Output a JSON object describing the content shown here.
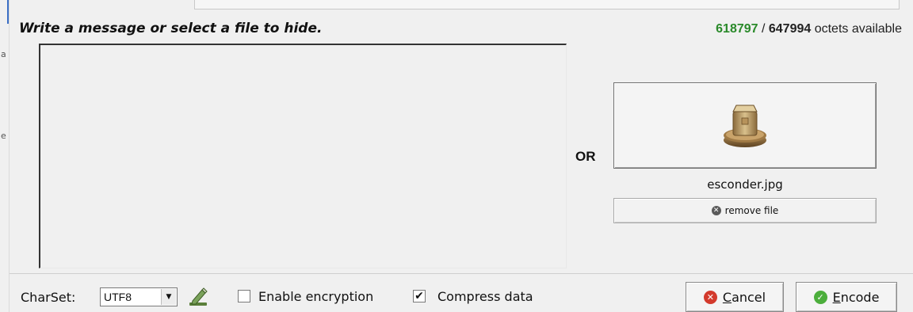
{
  "header": {
    "headline": "Write a message or select a file to hide.",
    "capacity": {
      "free": "618797",
      "separator": " / ",
      "total": "647994",
      "suffix": " octets available"
    }
  },
  "left_edge": {
    "tick_top": "a",
    "tick_mid": "e"
  },
  "message": {
    "value": "",
    "placeholder": ""
  },
  "or_label": "OR",
  "file": {
    "icon": "package-icon",
    "name": "esconder.jpg",
    "remove_label": "remove file"
  },
  "footer": {
    "charset_label": "CharSet:",
    "charset_value": "UTF8",
    "pen_icon": "pen-icon",
    "encryption_label": "Enable encryption",
    "encryption_checked": false,
    "compress_label": "Compress data",
    "compress_checked": true,
    "cancel_label": "Cancel",
    "encode_label": "Encode"
  },
  "colors": {
    "free_count": "#2a8a2a",
    "cancel_icon": "#d33a2c",
    "encode_icon": "#4cae3c"
  }
}
